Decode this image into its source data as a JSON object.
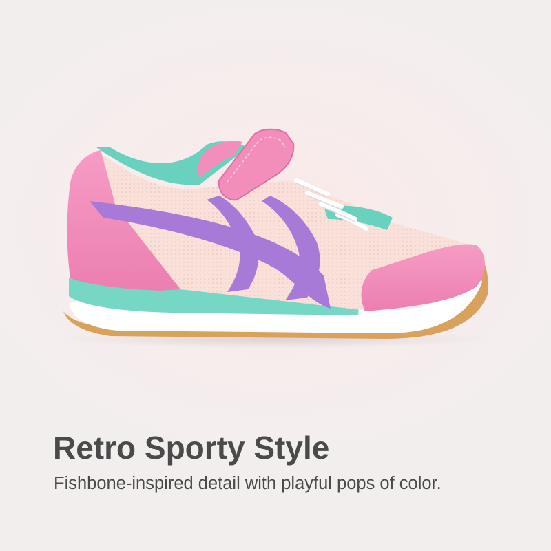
{
  "headline": "Retro Sporty Style",
  "subline": "Fishbone-inspired detail with playful pops of color.",
  "product_image": {
    "subject": "sneaker-icon",
    "colors": {
      "upper_pink": "#f18bb8",
      "mesh_peach": "#f8ddd5",
      "stripe_purple": "#a77ad8",
      "collar_mint": "#69d1bd",
      "midsole_mint": "#76d7c4",
      "sole_white": "#ffffff",
      "gum_outsole": "#d9a25c",
      "laces": "#ffffff"
    }
  },
  "colors": {
    "text": "#4a4a4a",
    "background": "#f4eceb"
  }
}
